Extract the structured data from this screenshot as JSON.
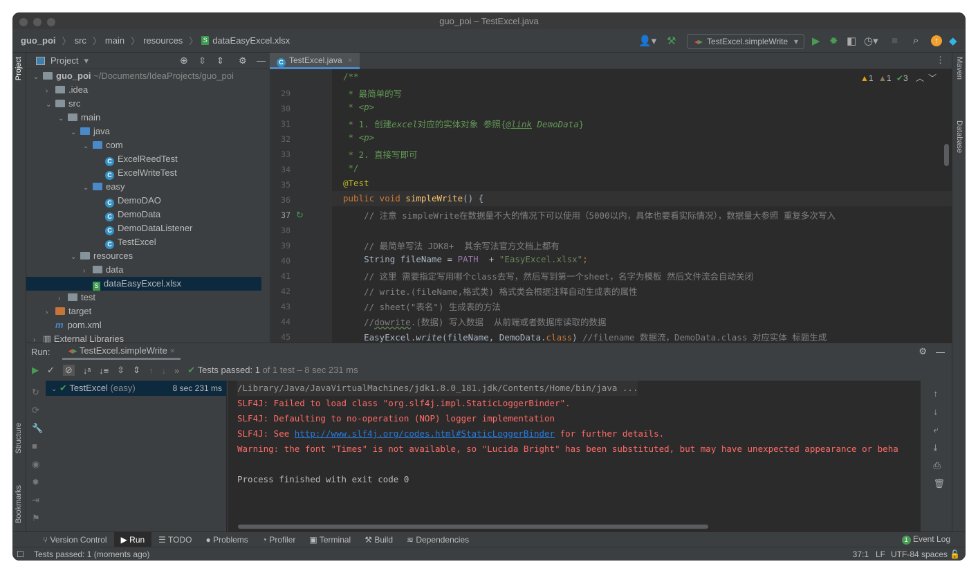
{
  "window": {
    "title": "guo_poi – TestExcel.java"
  },
  "breadcrumb": [
    "guo_poi",
    "src",
    "main",
    "resources",
    "dataEasyExcel.xlsx"
  ],
  "toolbar": {
    "run_config": "TestExcel.simpleWrite"
  },
  "project": {
    "title": "Project",
    "tree": [
      {
        "d": 0,
        "label": "guo_poi",
        "extra": "~/Documents/IdeaProjects/guo_poi",
        "icon": "folder",
        "open": true
      },
      {
        "d": 1,
        "label": ".idea",
        "icon": "folder",
        "open": false
      },
      {
        "d": 1,
        "label": "src",
        "icon": "folder",
        "open": true
      },
      {
        "d": 2,
        "label": "main",
        "icon": "folder",
        "open": true
      },
      {
        "d": 3,
        "label": "java",
        "icon": "folder-blue",
        "open": true
      },
      {
        "d": 4,
        "label": "com",
        "icon": "package",
        "open": true
      },
      {
        "d": 5,
        "label": "ExcelReedTest",
        "icon": "class"
      },
      {
        "d": 5,
        "label": "ExcelWriteTest",
        "icon": "class"
      },
      {
        "d": 4,
        "label": "easy",
        "icon": "package",
        "open": true
      },
      {
        "d": 5,
        "label": "DemoDAO",
        "icon": "class"
      },
      {
        "d": 5,
        "label": "DemoData",
        "icon": "class"
      },
      {
        "d": 5,
        "label": "DemoDataListener",
        "icon": "class"
      },
      {
        "d": 5,
        "label": "TestExcel",
        "icon": "class"
      },
      {
        "d": 3,
        "label": "resources",
        "icon": "folder",
        "open": true
      },
      {
        "d": 4,
        "label": "data",
        "icon": "folder",
        "open": false
      },
      {
        "d": 4,
        "label": "dataEasyExcel.xlsx",
        "icon": "xlsx",
        "selected": true
      },
      {
        "d": 2,
        "label": "test",
        "icon": "folder",
        "open": false
      },
      {
        "d": 1,
        "label": "target",
        "icon": "folder-orange",
        "open": false
      },
      {
        "d": 1,
        "label": "pom.xml",
        "icon": "maven"
      },
      {
        "d": 0,
        "label": "External Libraries",
        "icon": "lib",
        "open": false
      }
    ]
  },
  "editor": {
    "tab": "TestExcel.java",
    "inspections": {
      "warnings": "1",
      "weak_warnings": "1",
      "typos": "3"
    },
    "current_line": 37,
    "lines": [
      {
        "n": 29,
        "segs": [
          [
            "/**",
            "c-doc"
          ]
        ]
      },
      {
        "n": 30,
        "segs": [
          [
            " * 最简单的写",
            "c-doc"
          ]
        ]
      },
      {
        "n": 31,
        "segs": [
          [
            " * ",
            "c-doc"
          ],
          [
            "<p>",
            "c-it"
          ]
        ]
      },
      {
        "n": 32,
        "segs": [
          [
            " * 1. 创建",
            "c-doc"
          ],
          [
            "excel",
            "c-it"
          ],
          [
            "对应的实体对象 参照{",
            "c-doc"
          ],
          [
            "@link",
            "c-tag"
          ],
          [
            " DemoData",
            "c-it"
          ],
          [
            "}",
            "c-doc"
          ]
        ]
      },
      {
        "n": 33,
        "segs": [
          [
            " * ",
            "c-doc"
          ],
          [
            "<p>",
            "c-it"
          ]
        ]
      },
      {
        "n": 34,
        "segs": [
          [
            " * 2. 直接写即可",
            "c-doc"
          ]
        ]
      },
      {
        "n": 35,
        "segs": [
          [
            " */",
            "c-doc"
          ]
        ]
      },
      {
        "n": 36,
        "segs": [
          [
            "@Test",
            "c-ann"
          ]
        ]
      },
      {
        "n": 37,
        "segs": [
          [
            "public void ",
            "c-kw"
          ],
          [
            "simpleWrite",
            "c-fn"
          ],
          [
            "() {",
            ""
          ]
        ]
      },
      {
        "n": 38,
        "segs": [
          [
            "    // 注意 simpleWrite在数据量不大的情况下可以使用（5000以内，具体也要看实际情况），数据量大参照 重复多次写入",
            "c-cm"
          ]
        ]
      },
      {
        "n": 39,
        "segs": []
      },
      {
        "n": 40,
        "segs": [
          [
            "    // 最简单写法 JDK8+  其余写法官方文档上都有",
            "c-cm"
          ]
        ]
      },
      {
        "n": 41,
        "segs": [
          [
            "    String fileName = ",
            ""
          ],
          [
            "PATH",
            "c-const"
          ],
          [
            "  + ",
            ""
          ],
          [
            "\"EasyExcel.xlsx\"",
            "c-str"
          ],
          [
            ";",
            "c-kw"
          ]
        ]
      },
      {
        "n": 42,
        "segs": [
          [
            "    // 这里 需要指定写用哪个class去写，然后写到第一个sheet，名字为模板 然后文件流会自动关闭",
            "c-cm"
          ]
        ]
      },
      {
        "n": 43,
        "segs": [
          [
            "    // write.(fileName,格式类) 格式类会根据注释自动生成表的属性",
            "c-cm"
          ]
        ]
      },
      {
        "n": 44,
        "segs": [
          [
            "    // sheet(\"表名\") 生成表的方法",
            "c-cm"
          ]
        ]
      },
      {
        "n": 45,
        "segs": [
          [
            "    //",
            "c-cm"
          ],
          [
            "dowrite",
            "c-cm c-typo"
          ],
          [
            ".(数据) 写入数据  从前端或者数据库读取的数据",
            "c-cm"
          ]
        ]
      },
      {
        "n": 46,
        "segs": [
          [
            "    EasyExcel.",
            ""
          ],
          [
            "write",
            "c-itfn"
          ],
          [
            "(fileName, DemoData.",
            ""
          ],
          [
            "class",
            "c-kw"
          ],
          [
            ") ",
            ""
          ],
          [
            "//filename 数据流，DemoData.class 对应实体 标题生成",
            "c-cm"
          ]
        ]
      }
    ]
  },
  "run": {
    "label": "Run:",
    "tab": "TestExcel.simpleWrite",
    "status": {
      "prefix": "Tests passed:",
      "count": "1",
      "suffix": "of 1 test – 8 sec 231 ms"
    },
    "test": {
      "name": "TestExcel",
      "pkg": "(easy)",
      "time": "8 sec 231 ms"
    },
    "console": [
      {
        "text": "/Library/Java/JavaVirtualMachines/jdk1.8.0_181.jdk/Contents/Home/bin/java ...",
        "cls": ""
      },
      {
        "text": "SLF4J: Failed to load class \"org.slf4j.impl.StaticLoggerBinder\".",
        "cls": "red"
      },
      {
        "text": "SLF4J: Defaulting to no-operation (NOP) logger implementation",
        "cls": "red"
      },
      {
        "text": "SLF4J: See ",
        "cls": "red",
        "link": "http://www.slf4j.org/codes.html#StaticLoggerBinder",
        "after": " for further details."
      },
      {
        "text": "Warning: the font \"Times\" is not available, so \"Lucida Bright\" has been substituted, but may have unexpected appearance or beha",
        "cls": "red"
      },
      {
        "text": "",
        "cls": ""
      },
      {
        "text": "Process finished with exit code 0",
        "cls": ""
      }
    ]
  },
  "side": {
    "left": [
      "Project",
      "Structure",
      "Bookmarks"
    ],
    "right": [
      "Maven",
      "Database"
    ]
  },
  "bottom_tabs": [
    "Version Control",
    "Run",
    "TODO",
    "Problems",
    "Profiler",
    "Terminal",
    "Build",
    "Dependencies"
  ],
  "event_log": {
    "label": "Event Log",
    "count": "1"
  },
  "status": {
    "message": "Tests passed: 1 (moments ago)",
    "position": "37:1",
    "line_sep": "LF",
    "encoding": "UTF-8",
    "indent": "4 spaces"
  }
}
